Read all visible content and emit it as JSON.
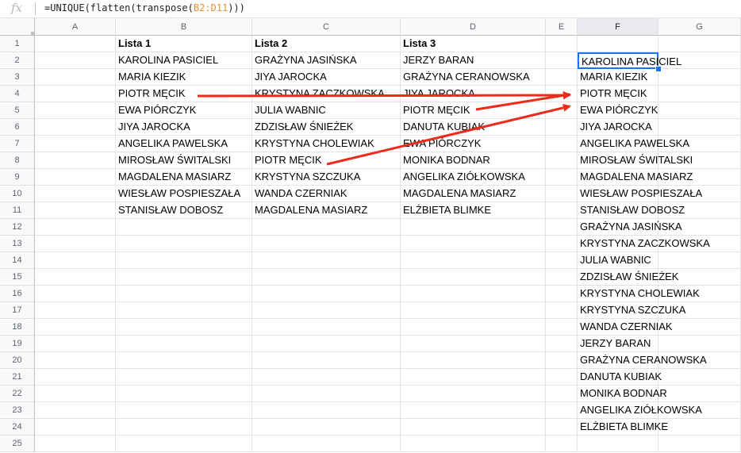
{
  "formula_bar": {
    "fx_label": "fx",
    "formula_prefix": "=UNIQUE(flatten(transpose(",
    "formula_ref": "B2:D11",
    "formula_suffix": ")))"
  },
  "columns": [
    "A",
    "B",
    "C",
    "D",
    "E",
    "F",
    "G"
  ],
  "rows": [
    "1",
    "2",
    "3",
    "4",
    "5",
    "6",
    "7",
    "8",
    "9",
    "10",
    "11",
    "12",
    "13",
    "14",
    "15",
    "16",
    "17",
    "18",
    "19",
    "20",
    "21",
    "22",
    "23",
    "24",
    "25"
  ],
  "lists": {
    "headers": [
      "Lista 1",
      "Lista 2",
      "Lista 3"
    ],
    "lista1": [
      "KAROLINA PASICIEL",
      "MARIA KIEZIK",
      "PIOTR MĘCIK",
      "EWA PIÓRCZYK",
      "JIYA JAROCKA",
      "ANGELIKA PAWELSKA",
      "MIROSŁAW ŚWITALSKI",
      "MAGDALENA MASIARZ",
      "WIESŁAW POSPIESZAŁA",
      "STANISŁAW DOBOSZ"
    ],
    "lista2": [
      "GRAŻYNA JASIŃSKA",
      "JIYA JAROCKA",
      "KRYSTYNA ZACZKOWSKA",
      "JULIA WABNIC",
      "ZDZISŁAW ŚNIEŻEK",
      "KRYSTYNA CHOLEWIAK",
      "PIOTR MĘCIK",
      "KRYSTYNA SZCZUKA",
      "WANDA CZERNIAK",
      "MAGDALENA MASIARZ"
    ],
    "lista3": [
      "JERZY BARAN",
      "GRAŻYNA CERANOWSKA",
      "JIYA JAROCKA",
      "PIOTR MĘCIK",
      "DANUTA KUBIAK",
      "EWA PIÓRCZYK",
      "MONIKA BODNAR",
      "ANGELIKA ZIÓŁKOWSKA",
      "MAGDALENA MASIARZ",
      "ELŻBIETA BLIMKE"
    ]
  },
  "unique_results": [
    "KAROLINA PASICIEL",
    "MARIA KIEZIK",
    "PIOTR MĘCIK",
    "EWA PIÓRCZYK",
    "JIYA JAROCKA",
    "ANGELIKA PAWELSKA",
    "MIROSŁAW ŚWITALSKI",
    "MAGDALENA MASIARZ",
    "WIESŁAW POSPIESZAŁA",
    "STANISŁAW DOBOSZ",
    "GRAŻYNA JASIŃSKA",
    "KRYSTYNA ZACZKOWSKA",
    "JULIA WABNIC",
    "ZDZISŁAW ŚNIEŻEK",
    "KRYSTYNA CHOLEWIAK",
    "KRYSTYNA SZCZUKA",
    "WANDA CZERNIAK",
    "JERZY BARAN",
    "GRAŻYNA CERANOWSKA",
    "DANUTA KUBIAK",
    "MONIKA BODNAR",
    "ANGELIKA ZIÓŁKOWSKA",
    "ELŻBIETA BLIMKE"
  ],
  "colors": {
    "arrow": "#ee2a1a",
    "selection": "#1a73e8",
    "formula_ref": "#e69138"
  },
  "active_column": "F",
  "active_cell": "F2"
}
